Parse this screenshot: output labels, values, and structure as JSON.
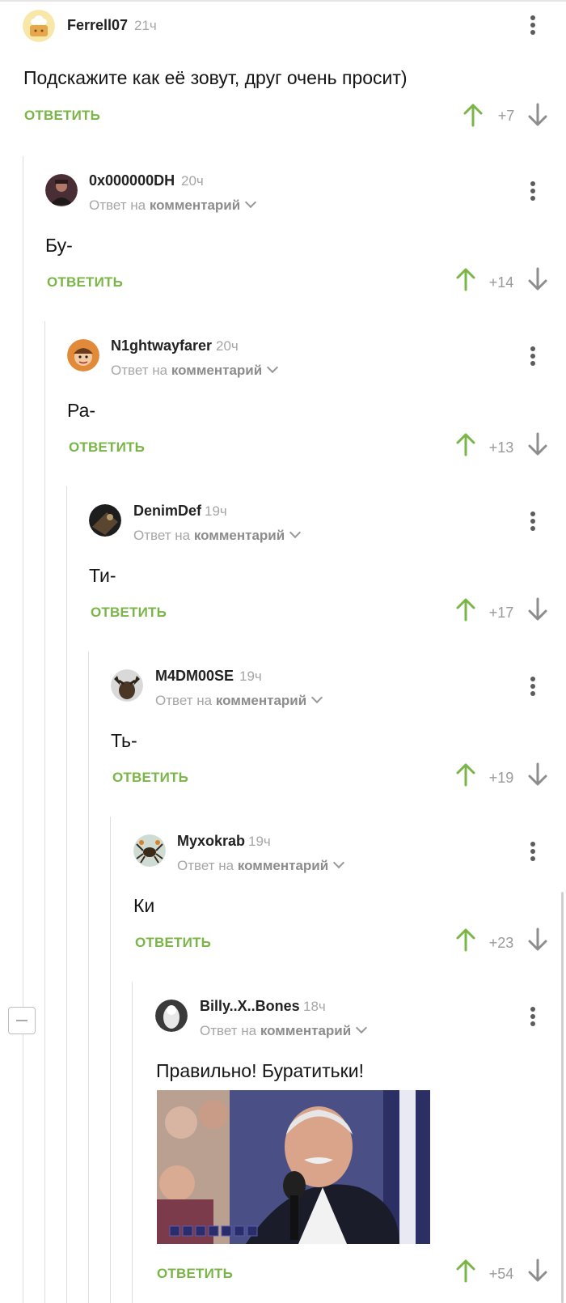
{
  "comments": [
    {
      "username": "Ferrell07",
      "time": "21ч",
      "text": "Подскажите как её зовут, друг очень просит)",
      "reply_label": "ОТВЕТИТЬ",
      "score": "+7"
    },
    {
      "username": "0x000000DH",
      "time": "20ч",
      "reply_to_prefix": "Ответ на",
      "reply_to_link": "комментарий",
      "text": "Бу-",
      "reply_label": "ОТВЕТИТЬ",
      "score": "+14"
    },
    {
      "username": "N1ghtwayfarer",
      "time": "20ч",
      "reply_to_prefix": "Ответ на",
      "reply_to_link": "комментарий",
      "text": "Ра-",
      "reply_label": "ОТВЕТИТЬ",
      "score": "+13"
    },
    {
      "username": "DenimDef",
      "time": "19ч",
      "reply_to_prefix": "Ответ на",
      "reply_to_link": "комментарий",
      "text": "Ти-",
      "reply_label": "ОТВЕТИТЬ",
      "score": "+17"
    },
    {
      "username": "M4DM00SE",
      "time": "19ч",
      "reply_to_prefix": "Ответ на",
      "reply_to_link": "комментарий",
      "text": "Ть-",
      "reply_label": "ОТВЕТИТЬ",
      "score": "+19"
    },
    {
      "username": "Myxokrab",
      "time": "19ч",
      "reply_to_prefix": "Ответ на",
      "reply_to_link": "комментарий",
      "text": "Ки",
      "reply_label": "ОТВЕТИТЬ",
      "score": "+23"
    },
    {
      "username": "Billy..X..Bones",
      "time": "18ч",
      "reply_to_prefix": "Ответ на",
      "reply_to_link": "комментарий",
      "text": "Правильно! Буратитьки!",
      "reply_label": "ОТВЕТИТЬ",
      "score": "+54"
    }
  ],
  "colors": {
    "accent": "#7ab547",
    "muted": "#a6a6a6",
    "text": "#151515"
  }
}
